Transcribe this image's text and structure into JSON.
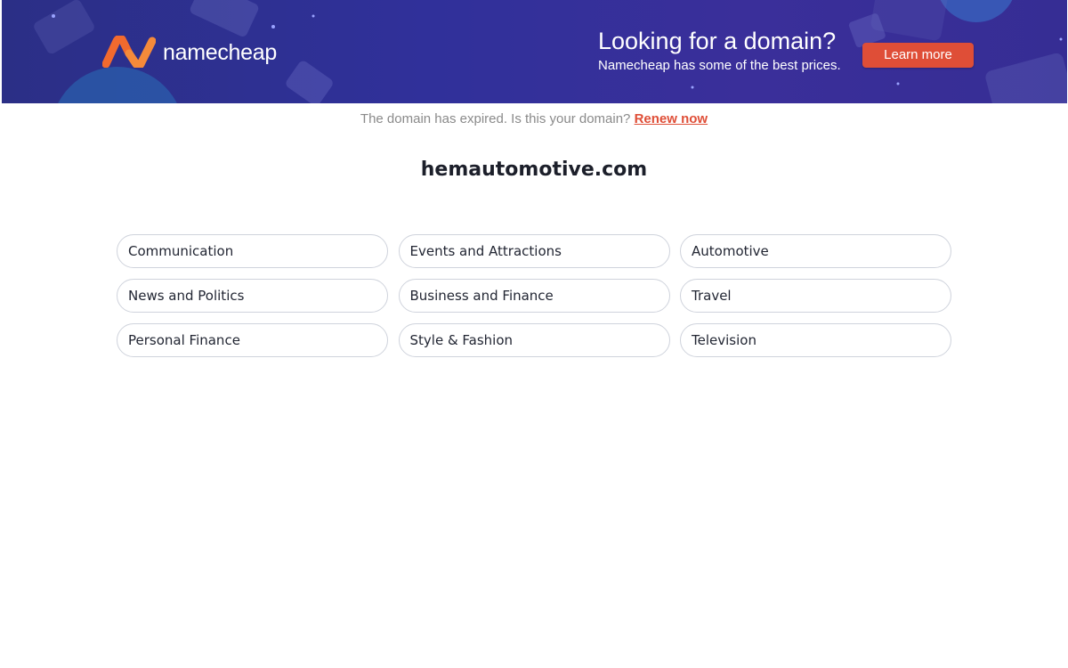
{
  "banner": {
    "logo_text": "namecheap",
    "promo_title": "Looking for a domain?",
    "promo_subtitle": "Namecheap has some of the best prices.",
    "learn_more_label": "Learn more",
    "colors": {
      "background": "#30309a",
      "accent": "#df4e37",
      "logo_orange": "#f26a2e"
    }
  },
  "notice": {
    "text": "The domain has expired. Is this your domain?",
    "renew_label": "Renew now"
  },
  "domain": "hemautomotive.com",
  "categories": [
    "Communication",
    "Events and Attractions",
    "Automotive",
    "News and Politics",
    "Business and Finance",
    "Travel",
    "Personal Finance",
    "Style & Fashion",
    "Television"
  ],
  "icons": [
    "namecheap-logo-icon"
  ]
}
